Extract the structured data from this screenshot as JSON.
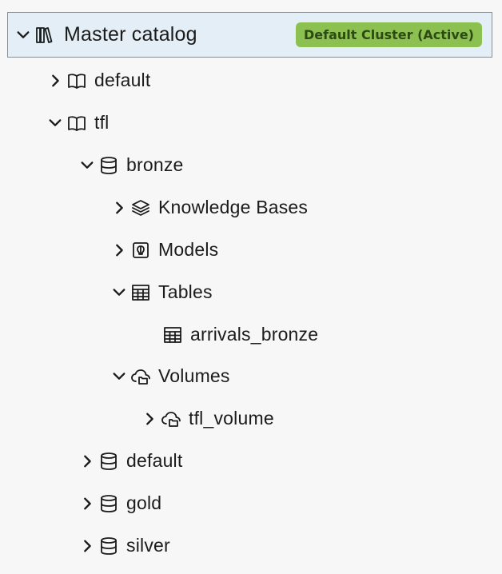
{
  "root": {
    "label": "Master catalog",
    "badge": "Default Cluster (Active)",
    "icon": "catalog-icon",
    "expanded": true
  },
  "catalogs": [
    {
      "label": "default",
      "icon": "book-icon",
      "expanded": false
    },
    {
      "label": "tfl",
      "icon": "book-icon",
      "expanded": true
    }
  ],
  "tfl_schemas": [
    {
      "label": "bronze",
      "icon": "database-icon",
      "expanded": true
    },
    {
      "label": "default",
      "icon": "database-icon",
      "expanded": false
    },
    {
      "label": "gold",
      "icon": "database-icon",
      "expanded": false
    },
    {
      "label": "silver",
      "icon": "database-icon",
      "expanded": false
    }
  ],
  "bronze_children": [
    {
      "label": "Knowledge Bases",
      "icon": "layers-icon",
      "expanded": false
    },
    {
      "label": "Models",
      "icon": "model-icon",
      "expanded": false
    },
    {
      "label": "Tables",
      "icon": "table-icon",
      "expanded": true
    },
    {
      "label": "Volumes",
      "icon": "cloud-folder-icon",
      "expanded": true
    }
  ],
  "tables": [
    {
      "label": "arrivals_bronze",
      "icon": "table-icon"
    }
  ],
  "volumes": [
    {
      "label": "tfl_volume",
      "icon": "cloud-folder-icon",
      "expanded": false
    }
  ]
}
